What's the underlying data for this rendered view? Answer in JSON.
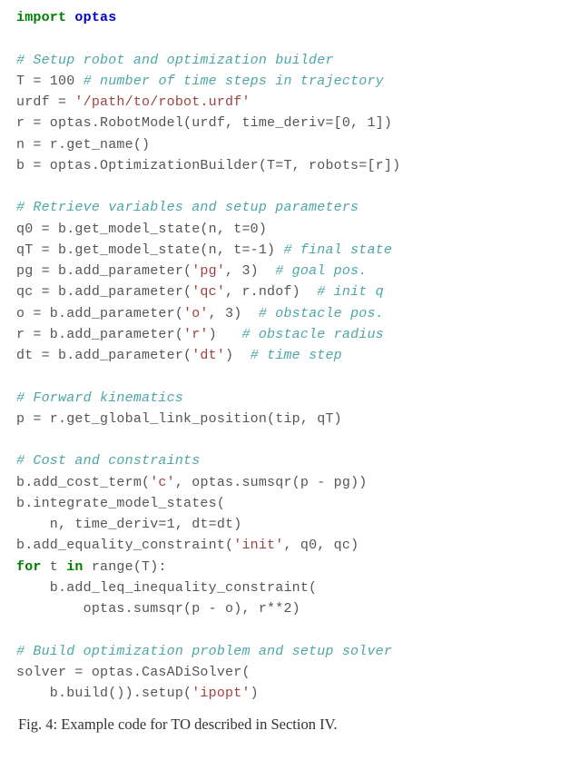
{
  "code": {
    "l01_kw": "import",
    "l01_mod": "optas",
    "l03_cm": "# Setup robot and optimization builder",
    "l04_a": "T = 100 ",
    "l04_cm": "# number of time steps in trajectory",
    "l05_a": "urdf = ",
    "l05_s": "'/path/to/robot.urdf'",
    "l06": "r = optas.RobotModel(urdf, time_deriv=[0, 1])",
    "l07": "n = r.get_name()",
    "l08": "b = optas.OptimizationBuilder(T=T, robots=[r])",
    "l10_cm": "# Retrieve variables and setup parameters",
    "l11": "q0 = b.get_model_state(n, t=0)",
    "l12_a": "qT = b.get_model_state(n, t=-1) ",
    "l12_cm": "# final state",
    "l13_a": "pg = b.add_parameter(",
    "l13_s": "'pg'",
    "l13_b": ", 3)  ",
    "l13_cm": "# goal pos.",
    "l14_a": "qc = b.add_parameter(",
    "l14_s": "'qc'",
    "l14_b": ", r.ndof)  ",
    "l14_cm": "# init q",
    "l15_a": "o = b.add_parameter(",
    "l15_s": "'o'",
    "l15_b": ", 3)  ",
    "l15_cm": "# obstacle pos.",
    "l16_a": "r = b.add_parameter(",
    "l16_s": "'r'",
    "l16_b": ")   ",
    "l16_cm": "# obstacle radius",
    "l17_a": "dt = b.add_parameter(",
    "l17_s": "'dt'",
    "l17_b": ")  ",
    "l17_cm": "# time step",
    "l19_cm": "# Forward kinematics",
    "l20": "p = r.get_global_link_position(tip, qT)",
    "l22_cm": "# Cost and constraints",
    "l23_a": "b.add_cost_term(",
    "l23_s": "'c'",
    "l23_b": ", optas.sumsqr(p - pg))",
    "l24": "b.integrate_model_states(",
    "l25": "    n, time_deriv=1, dt=dt)",
    "l26_a": "b.add_equality_constraint(",
    "l26_s": "'init'",
    "l26_b": ", q0, qc)",
    "l27_kw1": "for",
    "l27_a": " t ",
    "l27_kw2": "in",
    "l27_b": " range(T):",
    "l28": "    b.add_leq_inequality_constraint(",
    "l29": "        optas.sumsqr(p - o), r**2)",
    "l31_cm": "# Build optimization problem and setup solver",
    "l32": "solver = optas.CasADiSolver(",
    "l33_a": "    b.build()).setup(",
    "l33_s": "'ipopt'",
    "l33_b": ")"
  },
  "caption": "Fig. 4: Example code for TO described in Section IV."
}
